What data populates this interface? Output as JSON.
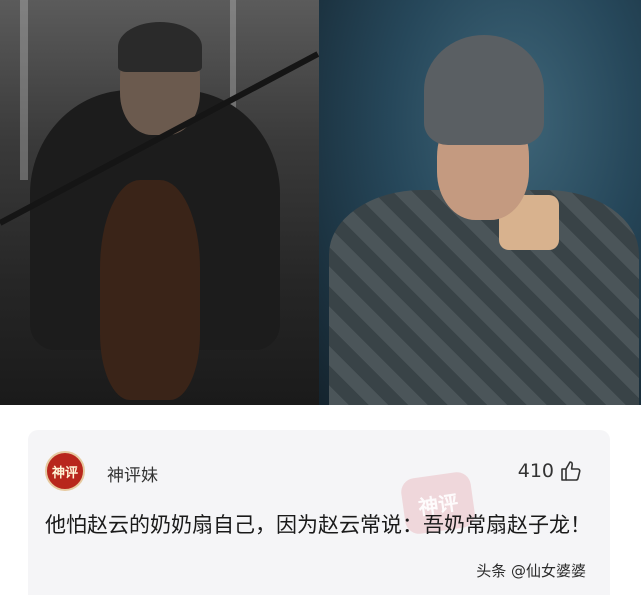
{
  "comment_card": {
    "avatar_text": "神评",
    "username": "神评妹",
    "like_count": "410",
    "like_icon": "thumbs-up-icon",
    "watermark_text": "神评",
    "comment_text": "他怕赵云的奶奶扇自己，因为赵云常说：吾奶常扇赵子龙！"
  },
  "source_label": "头条 @仙女婆婆"
}
